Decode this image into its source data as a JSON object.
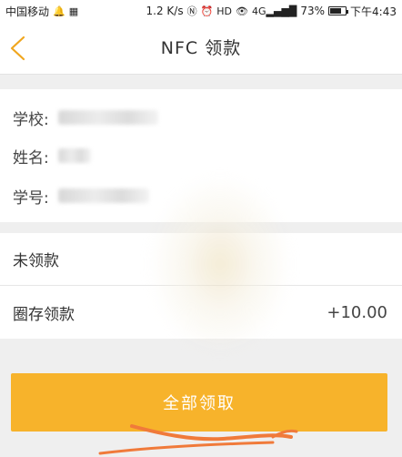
{
  "status_bar": {
    "carrier": "中国移动",
    "speed": "1.2 K/s",
    "signal_label": "4G",
    "battery": "73%",
    "battery_level": 0.73,
    "time": "下午4:43"
  },
  "nav": {
    "title": "NFC 领款"
  },
  "info": {
    "school_label": "学校:",
    "name_label": "姓名:",
    "student_id_label": "学号:"
  },
  "list": {
    "unclaimed_label": "未领款",
    "circle_label": "圈存领款",
    "circle_amount": "+10.00"
  },
  "action": {
    "claim_all_label": "全部领取"
  },
  "colors": {
    "accent": "#f7b32b",
    "back_arrow": "#f0a61e",
    "annotation_stroke": "#f07a3a"
  }
}
